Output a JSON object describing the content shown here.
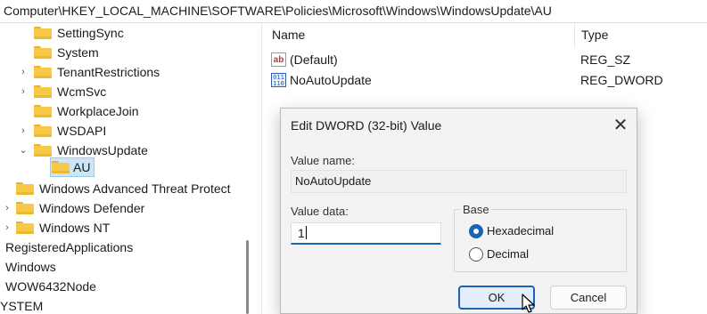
{
  "address_bar": {
    "path": "Computer\\HKEY_LOCAL_MACHINE\\SOFTWARE\\Policies\\Microsoft\\Windows\\WindowsUpdate\\AU"
  },
  "tree": {
    "items": [
      {
        "label": "SettingSync",
        "expander": ""
      },
      {
        "label": "System",
        "expander": ""
      },
      {
        "label": "TenantRestrictions",
        "expander": "›"
      },
      {
        "label": "WcmSvc",
        "expander": "›"
      },
      {
        "label": "WorkplaceJoin",
        "expander": ""
      },
      {
        "label": "WSDAPI",
        "expander": "›"
      },
      {
        "label": "WindowsUpdate",
        "expander": "⌄"
      },
      {
        "label": "AU",
        "expander": ""
      },
      {
        "label": "Windows Advanced Threat Protect",
        "expander": ""
      },
      {
        "label": "Windows Defender",
        "expander": "›"
      },
      {
        "label": "Windows NT",
        "expander": "›"
      },
      {
        "label": "RegisteredApplications",
        "expander": ""
      },
      {
        "label": "Windows",
        "expander": ""
      },
      {
        "label": "WOW6432Node",
        "expander": ""
      },
      {
        "label": "YSTEM",
        "expander": ""
      }
    ]
  },
  "values_list": {
    "columns": {
      "name": "Name",
      "type": "Type"
    },
    "rows": [
      {
        "icon": "string-value-icon",
        "icon_text": "ab",
        "name": "(Default)",
        "type": "REG_SZ"
      },
      {
        "icon": "binary-value-icon",
        "icon_text": "011\n110",
        "name": "NoAutoUpdate",
        "type": "REG_DWORD"
      }
    ]
  },
  "dialog": {
    "title": "Edit DWORD (32-bit) Value",
    "close_glyph": "✕",
    "value_name_label": "Value name:",
    "value_name": "NoAutoUpdate",
    "value_data_label": "Value data:",
    "value_data": "1",
    "base_label": "Base",
    "base_options": [
      {
        "label": "Hexadecimal",
        "selected": true
      },
      {
        "label": "Decimal",
        "selected": false
      }
    ],
    "ok_label": "OK",
    "cancel_label": "Cancel"
  },
  "colors": {
    "accent": "#1a63b8",
    "folder": "#f7c948",
    "selection": "#cde6f7"
  }
}
